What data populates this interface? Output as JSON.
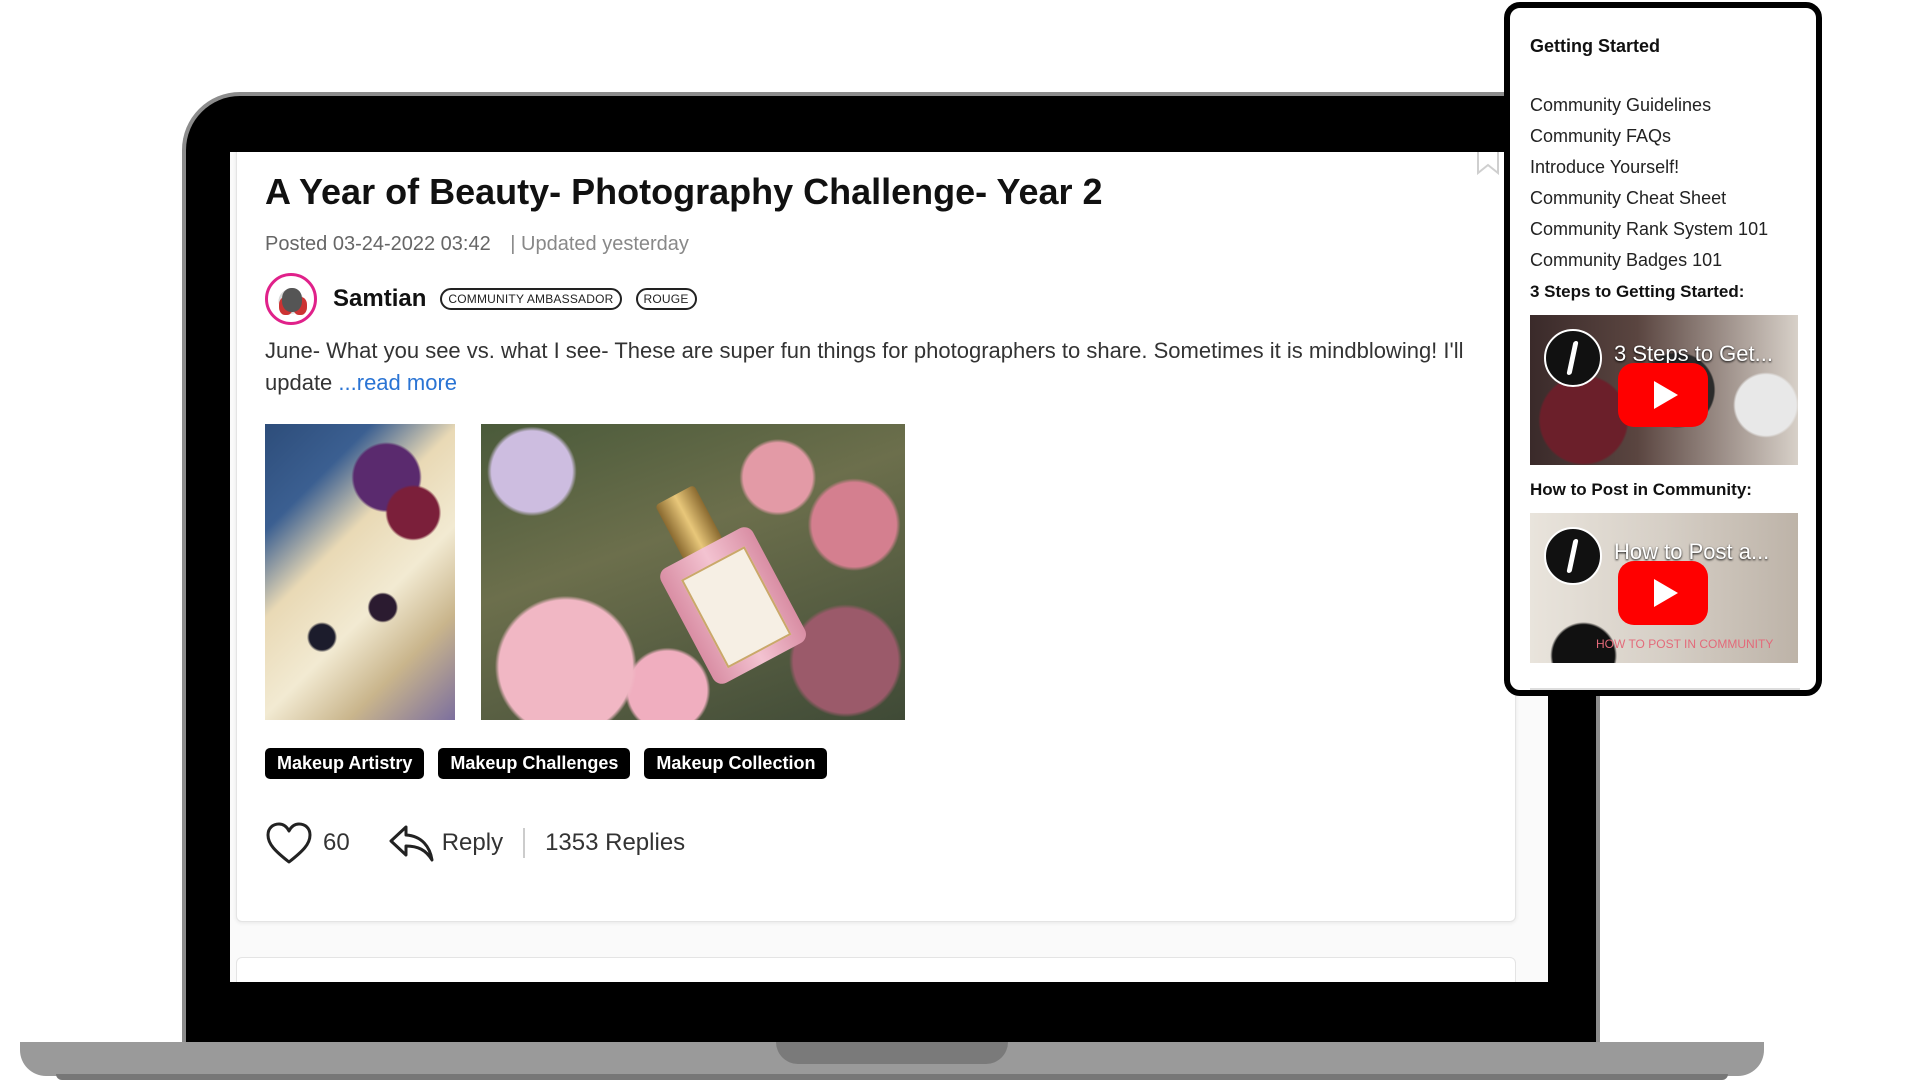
{
  "post": {
    "title": "A Year of Beauty- Photography Challenge- Year 2",
    "posted": "Posted 03-24-2022 03:42",
    "updated": "| Updated yesterday",
    "author": "Samtian",
    "badges": [
      "COMMUNITY AMBASSADOR",
      "ROUGE"
    ],
    "body": "June- What you see vs. what I see- These are super fun things for photographers to share. Sometimes it is mindblowing! I'll update ",
    "read_more": "...read more",
    "tags": [
      "Makeup Artistry",
      "Makeup Challenges",
      "Makeup Collection"
    ],
    "likes": "60",
    "reply_label": "Reply",
    "replies": "1353 Replies"
  },
  "sidebar": {
    "heading": "Getting Started",
    "links": [
      "Community Guidelines",
      "Community FAQs",
      "Introduce Yourself!",
      "Community Cheat Sheet",
      "Community Rank System 101",
      "Community Badges 101"
    ],
    "steps_heading": "3 Steps to Getting Started:",
    "video_1_title": "3 Steps to Get...",
    "post_heading": "How to Post in Community:",
    "video_2_title": "How to Post a...",
    "video_2_caption": "HOW TO POST IN COMMUNITY"
  },
  "colors": {
    "accent_link": "#2a74d4",
    "tag_bg": "#000000",
    "avatar_ring": "#e0218a",
    "youtube_red": "#ff0000"
  }
}
